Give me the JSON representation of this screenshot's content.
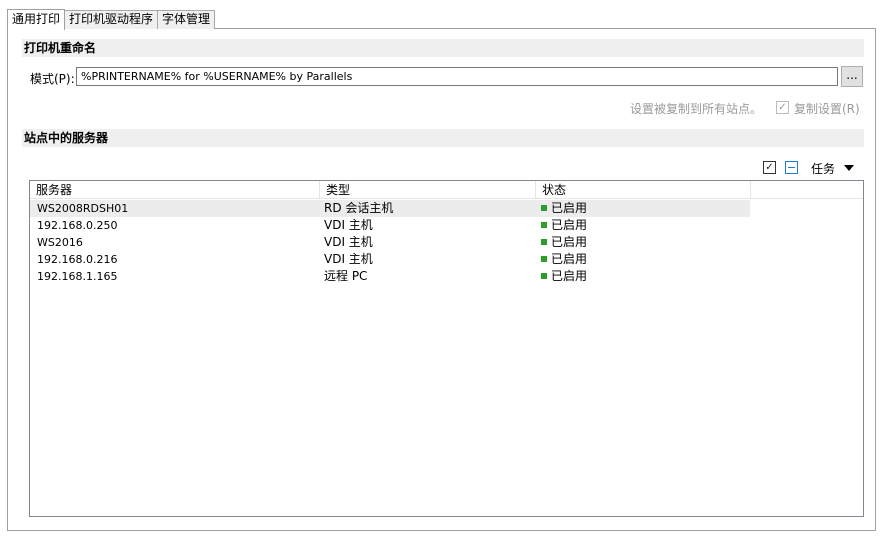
{
  "tabs": [
    {
      "label": "通用打印",
      "active": true
    },
    {
      "label": "打印机驱动程序",
      "active": false
    },
    {
      "label": "字体管理",
      "active": false
    }
  ],
  "rename": {
    "title": "打印机重命名",
    "pattern_label": "模式(P):",
    "pattern_value": "%PRINTERNAME% for %USERNAME% by Parallels",
    "browse_label": "...",
    "hint": "设置被复制到所有站点。",
    "copy_label": "复制设置(R)",
    "copy_checked": true
  },
  "servers": {
    "title": "站点中的服务器",
    "tasks_label": "任务",
    "check_icon": "checkbox-checked-icon",
    "minus_icon": "checkbox-indeterminate-icon",
    "columns": [
      "服务器",
      "类型",
      "状态"
    ],
    "rows": [
      {
        "server": "WS2008RDSH01",
        "type": "RD 会话主机",
        "status": "已启用"
      },
      {
        "server": "192.168.0.250",
        "type": "VDI 主机",
        "status": "已启用"
      },
      {
        "server": "WS2016",
        "type": "VDI 主机",
        "status": "已启用"
      },
      {
        "server": "192.168.0.216",
        "type": "VDI 主机",
        "status": "已启用"
      },
      {
        "server": "192.168.1.165",
        "type": "远程 PC",
        "status": "已启用"
      }
    ],
    "status_color": "#2aa02a"
  }
}
